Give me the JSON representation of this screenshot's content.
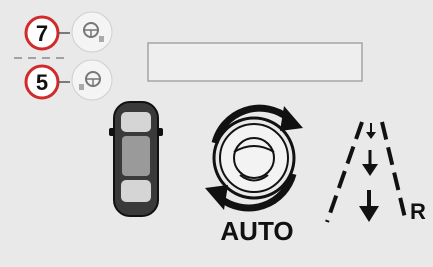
{
  "callouts": [
    {
      "number": "7",
      "icon": "steering-wheel-up-icon"
    },
    {
      "number": "5",
      "icon": "steering-wheel-down-icon"
    }
  ],
  "display": {
    "message_box_text": "",
    "mode_label": "AUTO",
    "reverse_label": "R"
  },
  "icons": {
    "vehicle": "car-top-view-icon",
    "steering": "steering-wheel-auto-icon",
    "lanes": "lane-guide-icon"
  },
  "colors": {
    "background": "#e9e9e9",
    "callout_ring": "#d02a2a",
    "callout_fill": "#ffffff",
    "icon_dark": "#1a1a1a",
    "icon_mid": "#8a8a8a",
    "message_box_border": "#9a9a9a"
  }
}
